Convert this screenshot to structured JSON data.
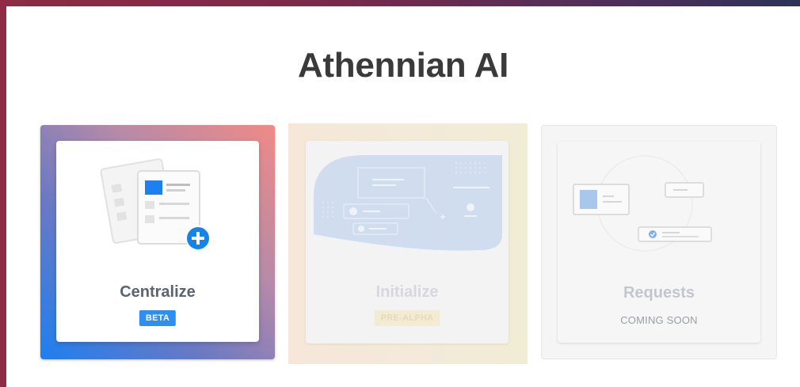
{
  "app": {
    "title": "Athennian AI"
  },
  "cards": [
    {
      "label": "Centralize",
      "badge": "BETA",
      "status": "enabled",
      "accent": "#1d7ff0"
    },
    {
      "label": "Initialize",
      "badge": "PRE-ALPHA",
      "status": "disabled",
      "accent": "#f6e7d8"
    },
    {
      "label": "Requests",
      "subtitle": "COMING SOON",
      "status": "disabled"
    }
  ],
  "icons": [
    "documents-add-icon",
    "workflow-illustration-icon",
    "requests-illustration-icon",
    "plus-icon",
    "check-icon"
  ],
  "colors": {
    "badge_blue": "#2f8ff0",
    "title_text": "#3a3a3a",
    "plus_blue": "#1683e8"
  }
}
